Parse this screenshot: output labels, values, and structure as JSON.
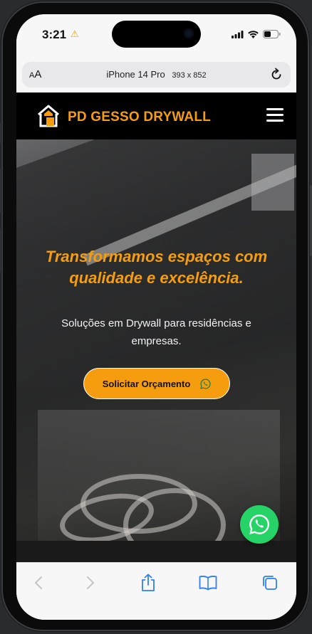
{
  "status_bar": {
    "time": "3:21",
    "warning_icon": "warning-icon"
  },
  "browser": {
    "text_size_label": "AA",
    "device_label": "iPhone 14 Pro",
    "device_size": "393 x 852",
    "reload_icon": "reload-icon"
  },
  "site": {
    "brand": "PD GESSO DRYWALL",
    "logo_icon": "house-logo-icon",
    "menu_icon": "hamburger-menu-icon",
    "hero": {
      "title": "Transformamos espaços com qualidade e excelência.",
      "subtitle": "Soluções em Drywall para residências e empresas.",
      "cta_label": "Solicitar Orçamento",
      "cta_icon": "whatsapp-icon"
    },
    "floating_button_icon": "whatsapp-icon"
  },
  "toolbar": {
    "items": [
      "back-icon",
      "forward-icon",
      "share-icon",
      "bookmarks-icon",
      "tabs-icon"
    ]
  },
  "colors": {
    "brand_orange": "#f59d0f",
    "whatsapp_green": "#25d366",
    "nav_black": "#000000"
  }
}
